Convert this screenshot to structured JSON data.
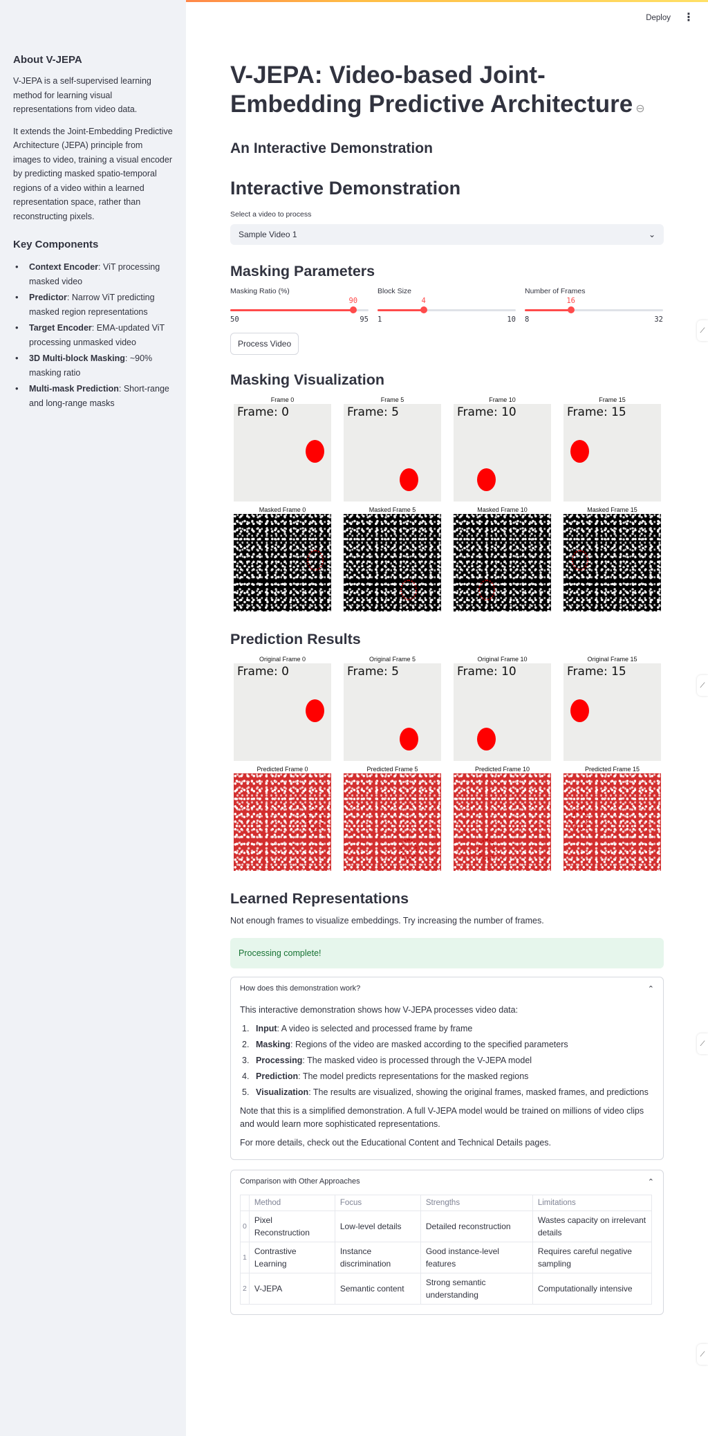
{
  "header": {
    "deploy_label": "Deploy",
    "menu_icon": "kebab-menu-icon"
  },
  "sidebar": {
    "title": "About V-JEPA",
    "para1": "V-JEPA is a self-supervised learning method for learning visual representations from video data.",
    "para2": "It extends the Joint-Embedding Predictive Architecture (JEPA) principle from images to video, training a visual encoder by predicting masked spatio-temporal regions of a video within a learned representation space, rather than reconstructing pixels.",
    "key_title": "Key Components",
    "components": [
      {
        "name": "Context Encoder",
        "desc": ": ViT processing masked video"
      },
      {
        "name": "Predictor",
        "desc": ": Narrow ViT predicting masked region representations"
      },
      {
        "name": "Target Encoder",
        "desc": ": EMA-updated ViT processing unmasked video"
      },
      {
        "name": "3D Multi-block Masking",
        "desc": ": ~90% masking ratio"
      },
      {
        "name": "Multi-mask Prediction",
        "desc": ": Short-range and long-range masks"
      }
    ]
  },
  "main": {
    "title": "V-JEPA: Video-based Joint-Embedding Predictive Architecture",
    "subtitle": "An Interactive Demonstration",
    "demo_heading": "Interactive Demonstration",
    "select_label": "Select a video to process",
    "select_value": "Sample Video 1",
    "masking_heading": "Masking Parameters",
    "sliders": [
      {
        "label": "Masking Ratio (%)",
        "value": 90,
        "min": 50,
        "max": 95
      },
      {
        "label": "Block Size",
        "value": 4,
        "min": 1,
        "max": 10
      },
      {
        "label": "Number of Frames",
        "value": 16,
        "min": 8,
        "max": 32
      }
    ],
    "process_button": "Process Video",
    "viz_heading": "Masking Visualization",
    "frames": [
      {
        "caption": "Frame 0",
        "text": "Frame: 0",
        "masked_caption": "Masked Frame 0",
        "orig_caption": "Original Frame 0",
        "pred_caption": "Predicted Frame 0"
      },
      {
        "caption": "Frame 5",
        "text": "Frame: 5",
        "masked_caption": "Masked Frame 5",
        "orig_caption": "Original Frame 5",
        "pred_caption": "Predicted Frame 5"
      },
      {
        "caption": "Frame 10",
        "text": "Frame: 10",
        "masked_caption": "Masked Frame 10",
        "orig_caption": "Original Frame 10",
        "pred_caption": "Predicted Frame 10"
      },
      {
        "caption": "Frame 15",
        "text": "Frame: 15",
        "masked_caption": "Masked Frame 15",
        "orig_caption": "Original Frame 15",
        "pred_caption": "Predicted Frame 15"
      }
    ],
    "pred_heading": "Prediction Results",
    "learned_heading": "Learned Representations",
    "learned_text": "Not enough frames to visualize embeddings. Try increasing the number of frames.",
    "success_text": "Processing complete!",
    "how": {
      "title": "How does this demonstration work?",
      "intro": "This interactive demonstration shows how V-JEPA processes video data:",
      "steps": [
        {
          "n": "1.",
          "name": "Input",
          "desc": ": A video is selected and processed frame by frame"
        },
        {
          "n": "2.",
          "name": "Masking",
          "desc": ": Regions of the video are masked according to the specified parameters"
        },
        {
          "n": "3.",
          "name": "Processing",
          "desc": ": The masked video is processed through the V-JEPA model"
        },
        {
          "n": "4.",
          "name": "Prediction",
          "desc": ": The model predicts representations for the masked regions"
        },
        {
          "n": "5.",
          "name": "Visualization",
          "desc": ": The results are visualized, showing the original frames, masked frames, and predictions"
        }
      ],
      "note": "Note that this is a simplified demonstration. A full V-JEPA model would be trained on millions of video clips and would learn more sophisticated representations.",
      "more": "For more details, check out the Educational Content and Technical Details pages."
    },
    "comparison": {
      "title": "Comparison with Other Approaches",
      "columns": [
        "Method",
        "Focus",
        "Strengths",
        "Limitations"
      ],
      "rows": [
        {
          "idx": "0",
          "cells": [
            "Pixel Reconstruction",
            "Low-level details",
            "Detailed reconstruction",
            "Wastes capacity on irrelevant details"
          ]
        },
        {
          "idx": "1",
          "cells": [
            "Contrastive Learning",
            "Instance discrimination",
            "Good instance-level features",
            "Requires careful negative sampling"
          ]
        },
        {
          "idx": "2",
          "cells": [
            "V-JEPA",
            "Semantic content",
            "Strong semantic understanding",
            "Computationally intensive"
          ]
        }
      ]
    }
  },
  "colors": {
    "accent": "#ff4b4b",
    "sidebar_bg": "#f0f2f6",
    "success_bg": "#e6f6ec",
    "success_text": "#177233"
  }
}
